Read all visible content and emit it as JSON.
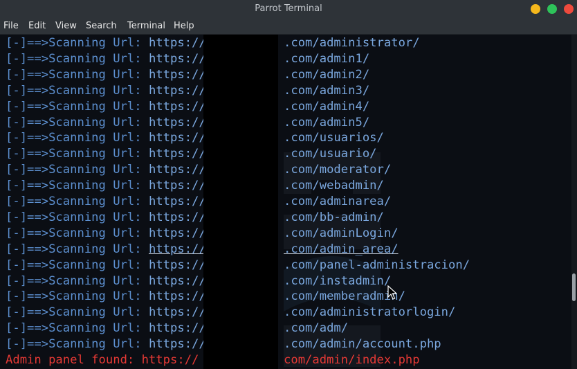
{
  "window": {
    "title": "Parrot Terminal",
    "buttons": {
      "minimize_color": "#f5b81c",
      "maximize_color": "#2ec35a",
      "close_color": "#ee4a3d"
    }
  },
  "menu": [
    "File",
    "Edit",
    "View",
    "Search",
    "Terminal",
    "Help"
  ],
  "terminal": {
    "prefix": "[-]==>Scanning Url: ",
    "scheme": "https://",
    "tails": [
      ".com/administrator/",
      ".com/admin1/",
      ".com/admin2/",
      ".com/admin3/",
      ".com/admin4/",
      ".com/admin5/",
      ".com/usuarios/",
      ".com/usuario/",
      ".com/moderator/",
      ".com/webadmin/",
      ".com/adminarea/",
      ".com/bb-admin/",
      ".com/adminLogin/",
      ".com/admin_area/",
      ".com/panel-administracion/",
      ".com/instadmin/",
      ".com/memberadmin/",
      ".com/administratorlogin/",
      ".com/adm/",
      ".com/admin/account.php"
    ],
    "found": {
      "prefix": "Admin panel found: ",
      "scheme": "https://",
      "tail": "com/admin/index.php"
    }
  },
  "colors": {
    "prompt": "#5c8fcf",
    "url": "#7aa7de",
    "found": "#e53935",
    "background": "#0b0e14"
  }
}
